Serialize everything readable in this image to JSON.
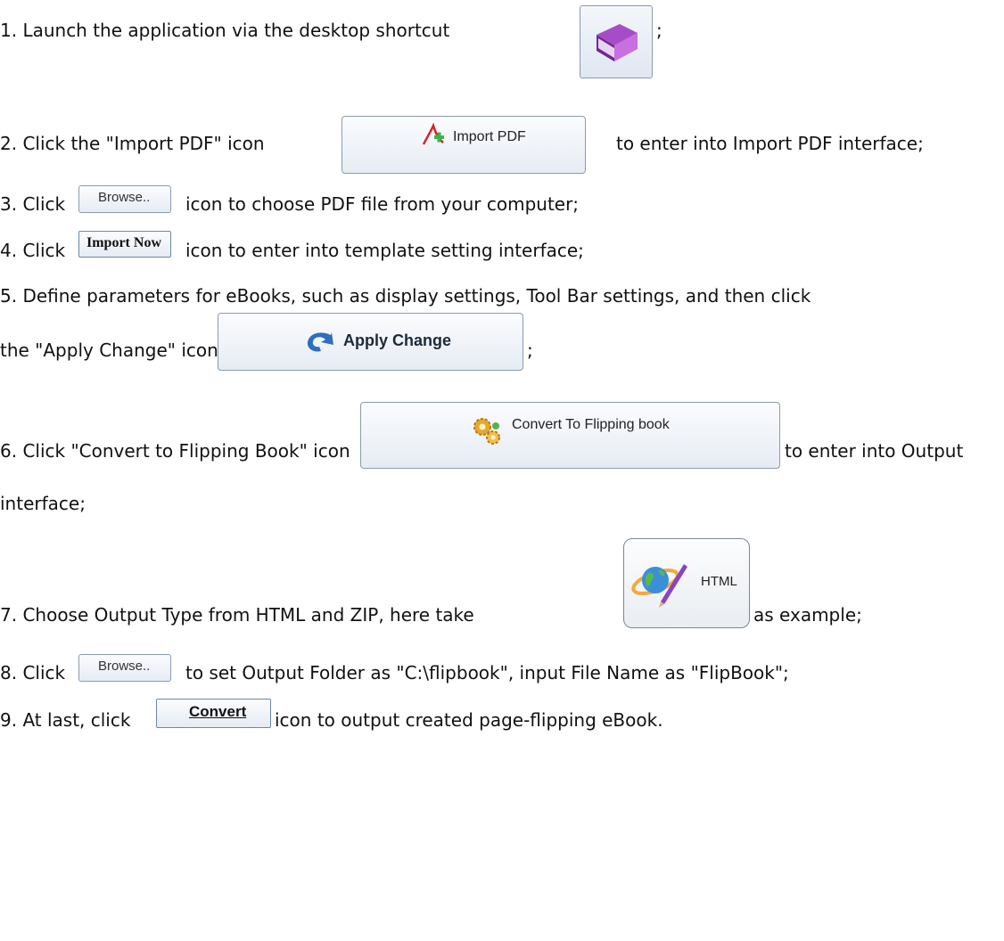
{
  "steps": [
    {
      "before": "1. Launch the application via the desktop shortcut",
      "after": ";"
    },
    {
      "before": "2. Click the \"Import PDF\" icon",
      "after": "to enter into Import PDF interface;",
      "button": "Import PDF"
    },
    {
      "before": "3. Click",
      "after": "icon to choose PDF file from your computer;",
      "button": "Browse.."
    },
    {
      "before": "4. Click",
      "after": "icon to enter into template setting interface;",
      "button": "Import Now"
    },
    {
      "line1": "5. Define parameters for eBooks, such as display settings, Tool Bar settings, and then click",
      "before": "the \"Apply Change\" icon",
      "after": ";",
      "button": "Apply Change"
    },
    {
      "before": "6. Click \"Convert to Flipping Book\" icon",
      "after": "to enter into Output",
      "after2": "interface;",
      "button": "Convert To Flipping book"
    },
    {
      "before": "7. Choose Output Type from HTML and ZIP, here take",
      "after": "as example;",
      "button": "HTML"
    },
    {
      "before": "8. Click",
      "after": "to set Output Folder as \"C:\\flipbook\", input File Name as \"FlipBook\";",
      "button": "Browse.."
    },
    {
      "before": "9. At last, click",
      "after": "icon to output created page-flipping eBook.",
      "button": "Convert"
    }
  ],
  "icons": [
    "book-icon",
    "pdf-add-icon",
    "refresh-arrow-icon",
    "gears-icon",
    "globe-pen-icon"
  ]
}
